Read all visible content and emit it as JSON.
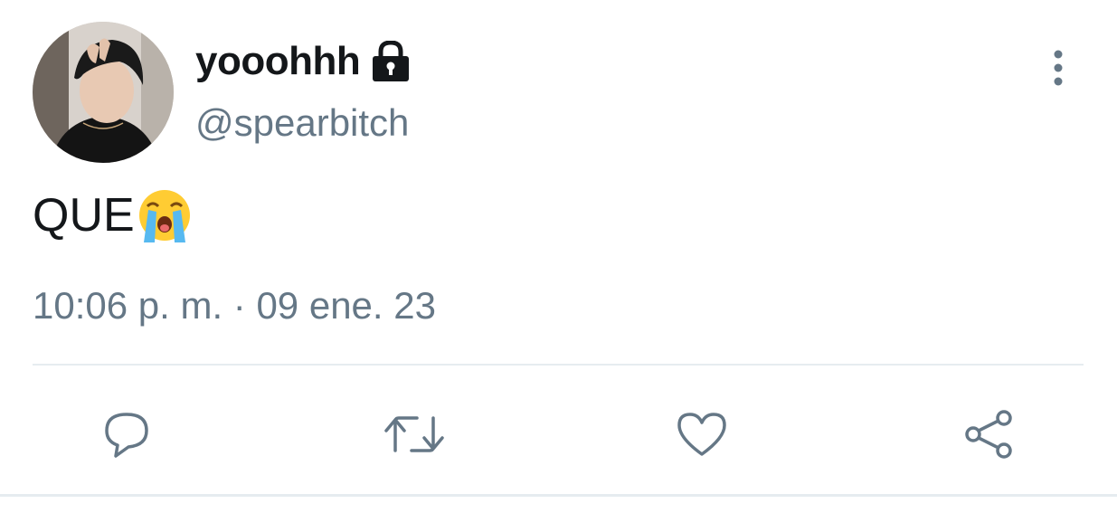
{
  "tweet": {
    "display_name": "yooohhh",
    "handle": "@spearbitch",
    "text": "QUE",
    "emoji": "loudly-crying-face",
    "timestamp": "10:06 p. m. · 09 ene. 23",
    "protected_icon": "lock-icon"
  },
  "actions": [
    {
      "name": "reply",
      "icon": "reply-icon"
    },
    {
      "name": "retweet",
      "icon": "retweet-icon"
    },
    {
      "name": "like",
      "icon": "heart-icon"
    },
    {
      "name": "share",
      "icon": "share-icon"
    }
  ],
  "colors": {
    "text_primary": "#14171a",
    "text_secondary": "#657786",
    "icon": "#657786",
    "divider": "#e6ecf0",
    "background": "#ffffff"
  }
}
